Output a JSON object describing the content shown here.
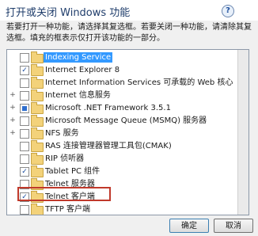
{
  "window": {
    "title": "打开或关闭 Windows 功能",
    "help_label": "?"
  },
  "description": "若要打开一种功能，请选择其复选框。若要关闭一种功能，请清除其复选框。填充的框表示仅打开该功能的一部分。",
  "features": [
    {
      "label": "Indexing Service",
      "state": "unchecked",
      "expandable": false,
      "selected": true
    },
    {
      "label": "Internet Explorer 8",
      "state": "checked",
      "expandable": false,
      "selected": false
    },
    {
      "label": "Internet Information Services 可承载的 Web 核心",
      "state": "unchecked",
      "expandable": false,
      "selected": false
    },
    {
      "label": "Internet 信息服务",
      "state": "unchecked",
      "expandable": true,
      "selected": false
    },
    {
      "label": "Microsoft .NET Framework 3.5.1",
      "state": "partial",
      "expandable": true,
      "selected": false
    },
    {
      "label": "Microsoft Message Queue (MSMQ) 服务器",
      "state": "unchecked",
      "expandable": true,
      "selected": false
    },
    {
      "label": "NFS 服务",
      "state": "unchecked",
      "expandable": true,
      "selected": false
    },
    {
      "label": "RAS 连接管理器管理工具包(CMAK)",
      "state": "unchecked",
      "expandable": false,
      "selected": false
    },
    {
      "label": "RIP 侦听器",
      "state": "unchecked",
      "expandable": false,
      "selected": false
    },
    {
      "label": "Tablet PC 组件",
      "state": "checked",
      "expandable": false,
      "selected": false
    },
    {
      "label": "Telnet 服务器",
      "state": "unchecked",
      "expandable": false,
      "selected": false
    },
    {
      "label": "Telnet 客户端",
      "state": "checked",
      "expandable": false,
      "selected": false
    },
    {
      "label": "TFTP 客户端",
      "state": "unchecked",
      "expandable": false,
      "selected": false
    }
  ],
  "buttons": {
    "ok": "确定",
    "cancel": "取消"
  },
  "colors": {
    "selection": "#3399ff",
    "annotation_box": "#c0392b",
    "folder": "#f3d27a"
  }
}
